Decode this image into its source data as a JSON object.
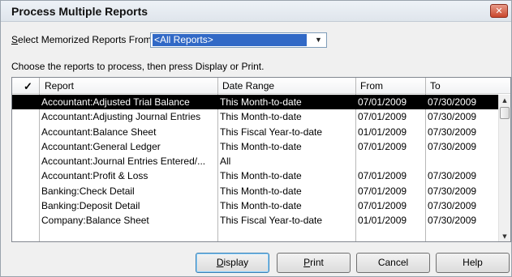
{
  "window": {
    "title": "Process Multiple Reports"
  },
  "icons": {
    "close": "close-icon",
    "dropdown": "chevron-down-icon",
    "check": "checkmark-icon",
    "scroll_up": "scroll-up-icon",
    "scroll_down": "scroll-down-icon"
  },
  "selector": {
    "label_accel": "S",
    "label_rest": "elect Memorized Reports From",
    "value": "<All Reports>"
  },
  "instructions": "Choose the reports to process, then press Display or Print.",
  "table": {
    "headers": {
      "check": "✓",
      "report": "Report",
      "date_range": "Date Range",
      "from": "From",
      "to": "To"
    },
    "rows": [
      {
        "report": "Accountant:Adjusted Trial Balance",
        "date_range": "This Month-to-date",
        "from": "07/01/2009",
        "to": "07/30/2009",
        "selected": true
      },
      {
        "report": "Accountant:Adjusting Journal Entries",
        "date_range": "This Month-to-date",
        "from": "07/01/2009",
        "to": "07/30/2009",
        "selected": false
      },
      {
        "report": "Accountant:Balance Sheet",
        "date_range": "This Fiscal Year-to-date",
        "from": "01/01/2009",
        "to": "07/30/2009",
        "selected": false
      },
      {
        "report": "Accountant:General Ledger",
        "date_range": "This Month-to-date",
        "from": "07/01/2009",
        "to": "07/30/2009",
        "selected": false
      },
      {
        "report": "Accountant:Journal Entries Entered/...",
        "date_range": "All",
        "from": "",
        "to": "",
        "selected": false
      },
      {
        "report": "Accountant:Profit & Loss",
        "date_range": "This Month-to-date",
        "from": "07/01/2009",
        "to": "07/30/2009",
        "selected": false
      },
      {
        "report": "Banking:Check Detail",
        "date_range": "This Month-to-date",
        "from": "07/01/2009",
        "to": "07/30/2009",
        "selected": false
      },
      {
        "report": "Banking:Deposit Detail",
        "date_range": "This Month-to-date",
        "from": "07/01/2009",
        "to": "07/30/2009",
        "selected": false
      },
      {
        "report": "Company:Balance Sheet",
        "date_range": "This Fiscal Year-to-date",
        "from": "01/01/2009",
        "to": "07/30/2009",
        "selected": false
      }
    ]
  },
  "buttons": {
    "display": {
      "accel": "D",
      "rest": "isplay"
    },
    "print": {
      "accel": "P",
      "rest": "rint"
    },
    "cancel": "Cancel",
    "help": "Help"
  }
}
